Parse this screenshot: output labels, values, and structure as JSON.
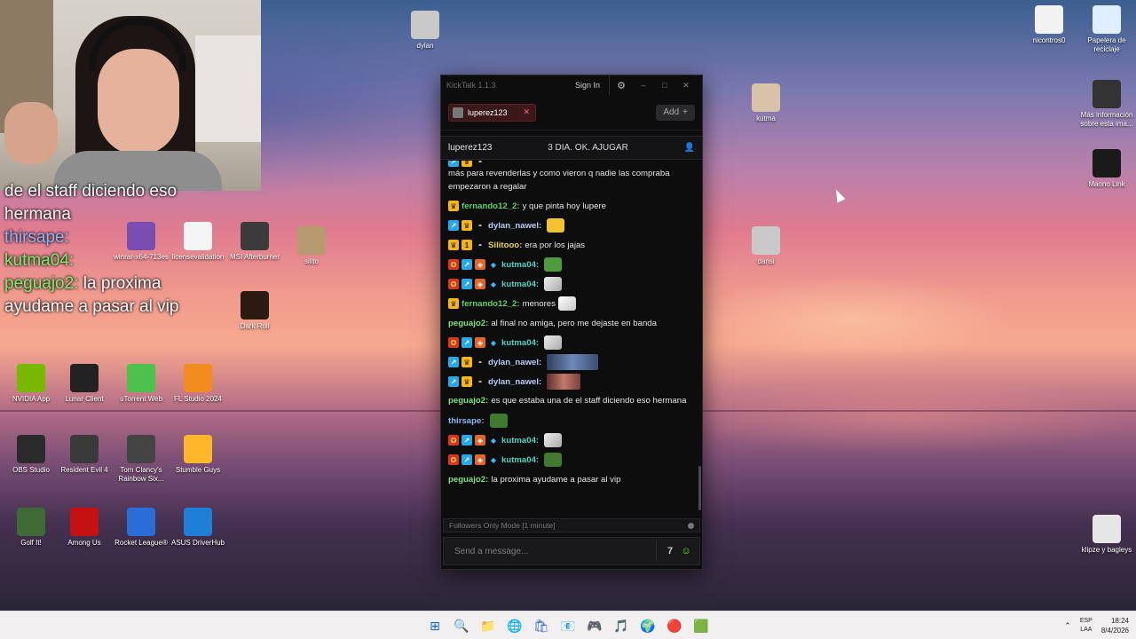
{
  "desktop": {
    "icons": [
      {
        "id": "dylan",
        "label": "dylan",
        "color": "#c9c9c9"
      },
      {
        "id": "kutma",
        "label": "kutma",
        "color": "#d8c2a8"
      },
      {
        "id": "dansi",
        "label": "dansi",
        "color": "#c9c9c9"
      },
      {
        "id": "nicotros",
        "label": "nicontros0",
        "color": "#f2f2f2"
      },
      {
        "id": "recycle",
        "label": "Papelera de reciclaje",
        "color": "#dfefff"
      },
      {
        "id": "info",
        "label": "Más información sobre esta ima...",
        "color": "#333333"
      },
      {
        "id": "maono",
        "label": "Maono Link",
        "color": "#1a1a1a"
      },
      {
        "id": "winrar",
        "label": "winrar-x64-713es",
        "color": "#7a4db0"
      },
      {
        "id": "license",
        "label": "licensevalidation",
        "color": "#f5f5f5"
      },
      {
        "id": "msi",
        "label": "MSI Afterburner",
        "color": "#3b3b3b"
      },
      {
        "id": "silito",
        "label": "silito",
        "color": "#b89a70"
      },
      {
        "id": "darksoul",
        "label": "Dark Roll",
        "color": "#2a1a10"
      },
      {
        "id": "nvidia",
        "label": "NVIDIA App",
        "color": "#76b900"
      },
      {
        "id": "lunar",
        "label": "Lunar Client",
        "color": "#222222"
      },
      {
        "id": "utorrent",
        "label": "uTorrent Web",
        "color": "#4cc14c"
      },
      {
        "id": "flstudio",
        "label": "FL Studio 2024",
        "color": "#f28c1f"
      },
      {
        "id": "obs",
        "label": "OBS Studio",
        "color": "#2b2b2b"
      },
      {
        "id": "re4",
        "label": "Resident Evil 4",
        "color": "#3a3a3a"
      },
      {
        "id": "r6",
        "label": "Tom Clancy's Rainbow Six...",
        "color": "#444444"
      },
      {
        "id": "stumble",
        "label": "Stumble Guys",
        "color": "#ffb72a"
      },
      {
        "id": "golfit",
        "label": "Golf It!",
        "color": "#3e6a35"
      },
      {
        "id": "amongus",
        "label": "Among Us",
        "color": "#c51111"
      },
      {
        "id": "rocket",
        "label": "Rocket League®",
        "color": "#2b6dd8"
      },
      {
        "id": "asus",
        "label": "ASUS DriverHub",
        "color": "#1f7fd8"
      },
      {
        "id": "klipze",
        "label": "klipze y bagleys",
        "color": "#e6e6e6"
      }
    ]
  },
  "overlay_chat": [
    {
      "user": "",
      "text": "de el staff diciendo eso"
    },
    {
      "user": "",
      "text": "hermana"
    },
    {
      "user": "thirsape:",
      "text": ""
    },
    {
      "user": "kutma04:",
      "text": ""
    },
    {
      "user": "peguajo2:",
      "text": "la proxima"
    },
    {
      "user": "",
      "text": "ayudame a pasar al vip"
    }
  ],
  "chat_window": {
    "title": "KickTalk 1.1.3",
    "sign_in": "Sign In",
    "gear": "⚙",
    "minimize": "–",
    "maximize": "□",
    "close": "✕",
    "tab_label": "luperez123",
    "tab_close": "✕",
    "add_label": "Add",
    "add_icon": "+",
    "channel_name": "luperez123",
    "stream_title": "3 DIA. OK. AJUGAR",
    "user_icon": "👤",
    "mode_text": "Followers Only Mode [1 minute]",
    "input_placeholder": "Send a message...",
    "seventv_icon": "7",
    "kick_emote_icon": "☺",
    "messages": [
      {
        "badges": [
          "b-sub",
          "b-crown",
          "b-mask"
        ],
        "user": "",
        "text": "más para revenderlas y como vieron q nadie las compraba empezaron a regalar",
        "emote": ""
      },
      {
        "badges": [
          "b-crown"
        ],
        "user": "fernando12_2:",
        "user_class": "u-green",
        "text": "y que pinta hoy lupere",
        "emote": ""
      },
      {
        "badges": [
          "b-sub",
          "b-crown",
          "b-mask"
        ],
        "user": "dylan_nawel:",
        "user_class": "u-light",
        "text": "",
        "emote": "em-gold"
      },
      {
        "badges": [
          "b-crown",
          "b-one",
          "b-mask"
        ],
        "user": "Silitooo:",
        "user_class": "u-yellow",
        "text": "era por los jajas",
        "emote": ""
      },
      {
        "badges": [
          "b-ork",
          "b-sub",
          "b-shield",
          "b-cube"
        ],
        "user": "kutma04:",
        "user_class": "u-cyan",
        "text": "",
        "emote": "em-frog"
      },
      {
        "badges": [
          "b-ork",
          "b-sub",
          "b-shield",
          "b-cube"
        ],
        "user": "kutma04:",
        "user_class": "u-cyan",
        "text": "",
        "emote": "em-cat"
      },
      {
        "badges": [
          "b-crown"
        ],
        "user": "fernando12_2:",
        "user_class": "u-green",
        "text": "menores",
        "emote": "em-blue"
      },
      {
        "badges": [],
        "user": "peguajo2:",
        "user_class": "u-lime",
        "text": "al final no amiga, pero me dejaste en banda",
        "emote": ""
      },
      {
        "badges": [
          "b-ork",
          "b-sub",
          "b-shield",
          "b-cube"
        ],
        "user": "kutma04:",
        "user_class": "u-cyan",
        "text": "",
        "emote": "em-cat"
      },
      {
        "badges": [
          "b-sub",
          "b-crown",
          "b-mask"
        ],
        "user": "dylan_nawel:",
        "user_class": "u-light",
        "text": "",
        "emote": "em-photo"
      },
      {
        "badges": [
          "b-sub",
          "b-crown",
          "b-mask"
        ],
        "user": "dylan_nawel:",
        "user_class": "u-light",
        "text": "",
        "emote": "em-photo2"
      },
      {
        "badges": [],
        "user": "peguajo2:",
        "user_class": "u-lime",
        "text": "es que estaba una de el staff diciendo eso hermana",
        "emote": ""
      },
      {
        "badges": [],
        "user": "thirsape:",
        "user_class": "u-blue",
        "text": "",
        "emote": "em-pepe"
      },
      {
        "badges": [
          "b-ork",
          "b-sub",
          "b-shield",
          "b-cube"
        ],
        "user": "kutma04:",
        "user_class": "u-cyan",
        "text": "",
        "emote": "em-cat"
      },
      {
        "badges": [
          "b-ork",
          "b-sub",
          "b-shield",
          "b-cube"
        ],
        "user": "kutma04:",
        "user_class": "u-cyan",
        "text": "",
        "emote": "em-pepe"
      },
      {
        "badges": [],
        "user": "peguajo2:",
        "user_class": "u-lime",
        "text": "la proxima ayudame a pasar al vip",
        "emote": ""
      }
    ]
  },
  "taskbar": {
    "start_icon": "⊞",
    "apps": [
      "🔍",
      "📁",
      "🌐",
      "🛍",
      "📧",
      "🎮",
      "🎵",
      "🌍",
      "🔴",
      "🟩"
    ],
    "tray_up": "⌃",
    "lang_line1": "ESP",
    "lang_line2": "LAA",
    "time": "18:24",
    "date": "8/4/2026"
  }
}
